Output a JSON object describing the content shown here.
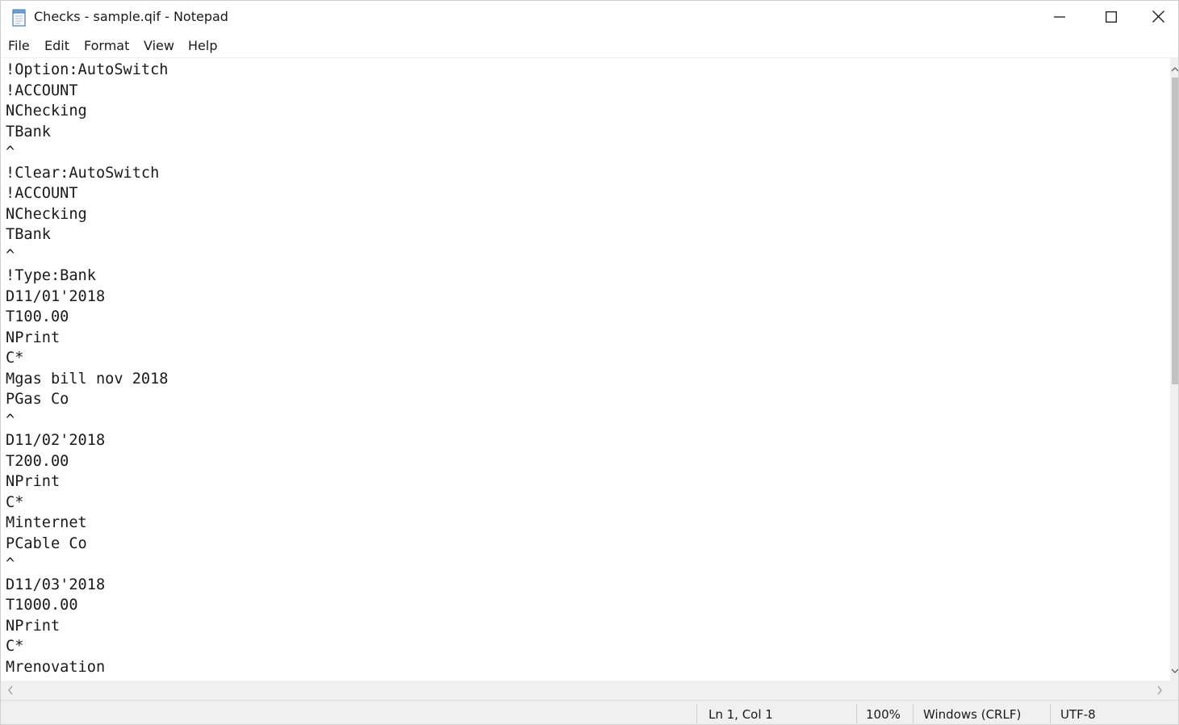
{
  "window": {
    "title": "Checks - sample.qif - Notepad",
    "icons": {
      "app": "notepad-icon",
      "minimize": "minimize-icon",
      "maximize": "maximize-icon",
      "close": "close-icon"
    }
  },
  "menu": {
    "items": [
      {
        "label": "File"
      },
      {
        "label": "Edit"
      },
      {
        "label": "Format"
      },
      {
        "label": "View"
      },
      {
        "label": "Help"
      }
    ]
  },
  "editor": {
    "lines": [
      "!Option:AutoSwitch",
      "!ACCOUNT",
      "NChecking",
      "TBank",
      "^",
      "!Clear:AutoSwitch",
      "!ACCOUNT",
      "NChecking",
      "TBank",
      "^",
      "!Type:Bank",
      "D11/01'2018",
      "T100.00",
      "NPrint",
      "C*",
      "Mgas bill nov 2018",
      "PGas Co",
      "^",
      "D11/02'2018",
      "T200.00",
      "NPrint",
      "C*",
      "Minternet",
      "PCable Co",
      "^",
      "D11/03'2018",
      "T1000.00",
      "NPrint",
      "C*",
      "Mrenovation"
    ]
  },
  "scrollbars": {
    "vertical_position": 0.0,
    "horizontal_position": 0.0
  },
  "status": {
    "position": "Ln 1, Col 1",
    "zoom": "100%",
    "line_endings": "Windows (CRLF)",
    "encoding": "UTF-8"
  },
  "colors": {
    "chrome_background": "#f0f0f0",
    "text": "#1a1a1a",
    "scroll_thumb": "#c2c2c2"
  }
}
